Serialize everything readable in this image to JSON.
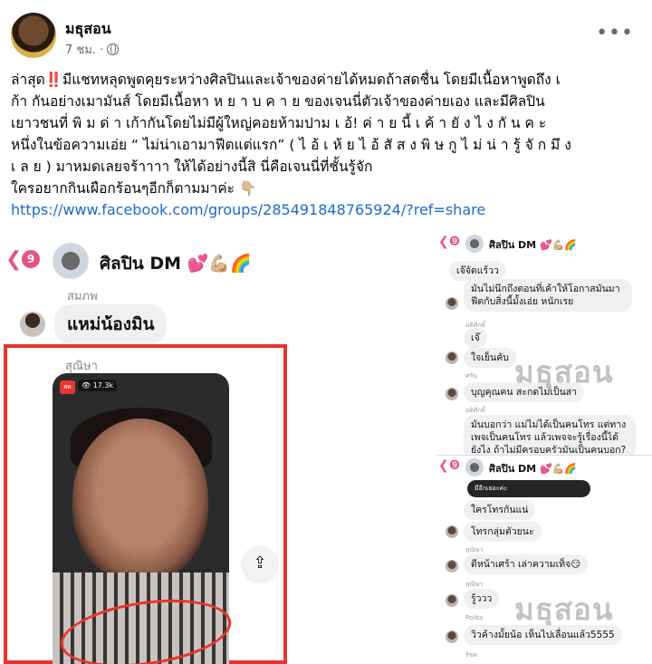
{
  "post": {
    "author": "มธุสอน",
    "time": "7 ชม. ·",
    "more_icon": "more-icon",
    "body_lines": [
      "ล่าสุด‼️มีแชทหลุดพูดคุยระหว่างศิลปินและเจ้าของค่ายได้หมดถ้าสดชื่น โดยมีเนื้อหาพูดถึง เ",
      "ก้า กันอย่างเมามันส์ โดยมีเนื้อหา ห ย า บ ค า ย ของเจนนี่ตัวเจ้าของค่ายเอง และมีศิลปิน",
      "เยาวชนที่ พิ ม ด่ า เก้ากันโดยไม่มีผู้ใหญ่คอยห้ามปาม เ อ้! ค่ า ย นี้ เ ค้ า ยั ง ไ ง กั น ค ะ",
      "หนึ่งในข้อความเอ่ย “ ไม่น่าเอามาฟีตแต่แรก” ( ไ อ้ เ ห้ ย ไ อ้ สั ส ง พิ ษ กู ไ ม่ น่ า รู้ จั ก มึ ง",
      "เ ล ย ) มาหมดเลยจร้าาาา ให้ได้อย่างนี้สิ นี่คือเจนนี่ที่ชั้นรู้จัก",
      "ใครอยากกินเผือกร้อนๆอีกก็ตามมาค่ะ 👇🏼"
    ],
    "link": "https://www.facebook.com/groups/285491848765924/?ref=share"
  },
  "left_chat": {
    "badge": "9",
    "group_title": "ศิลปิน DM 💕💪🏼🌈",
    "sender1": "สมภพ",
    "message1": "แหม่น้องมิน",
    "sender2": "สุณิษา",
    "live_label": "สด",
    "viewers": "👁 17.3k",
    "share_icon": "share-icon"
  },
  "right_chat": {
    "top_title": "ศิลปิน DM 💕💪🏼🌈",
    "messages": [
      {
        "name": "",
        "text": "เจ๊จัดแร้วว"
      },
      {
        "name": "",
        "text": "มันไม่นึกถึงตอนที่เค้าให้โอกาสมันมาฟีตกับสิ่งนี้มั้งเอ่ย หนักเรย"
      },
      {
        "name": "อดิศักดิ์",
        "text": "เจ๊"
      },
      {
        "name": "",
        "text": "ใจเย็นคับ"
      },
      {
        "name": "ศรัน",
        "text": "บุญคุณคน สะกดไม่เป็นสา"
      },
      {
        "name": "อดิศักดิ์",
        "text": "มันบอกว่า แม่ไม่ได้เป็นคนโทร แต่ทางเพจเป็นคนโทร แล้วเพจจะรู้เรื่องนี้ได้ยังไง ถ้าไม่มีครอบครัวมันเป็นคนบอก?"
      },
      {
        "name": "",
        "text": "ใครโทรกันแน่"
      },
      {
        "name": "",
        "text": "โทรกลุ่มตัวยนะ"
      },
      {
        "name": "สุณิษา",
        "text": "ดีหน้าเศร้า เล่าความเท็จ😏"
      },
      {
        "name": "สุณิษา",
        "text": "รู้ววว"
      },
      {
        "name": "Polita",
        "text": "วิวค้างมั้ยน้อ เห็นไปเลื่อนแล้ว5555"
      },
      {
        "name": "รัชต",
        "text": ""
      }
    ],
    "dark_bubble": "มีอีกเยอะค่ะ",
    "watermark": "มธุสอน"
  }
}
